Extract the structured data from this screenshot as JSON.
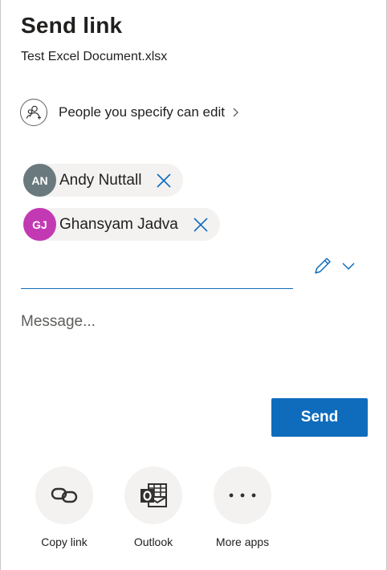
{
  "dialog": {
    "title": "Send link",
    "file_name": "Test Excel Document.xlsx"
  },
  "permission": {
    "label": "People you specify can edit",
    "icon": "people-icon"
  },
  "recipients": [
    {
      "initials": "AN",
      "name": "Andy Nuttall",
      "avatar_color": "#69797e"
    },
    {
      "initials": "GJ",
      "name": "Ghansyam Jadva",
      "avatar_color": "#c239b3"
    }
  ],
  "to_field": {
    "value": "",
    "placeholder": ""
  },
  "message": {
    "placeholder": "Message..."
  },
  "send_button": {
    "label": "Send",
    "color": "#0f6cbd"
  },
  "apps": [
    {
      "label": "Copy link",
      "icon": "link-icon"
    },
    {
      "label": "Outlook",
      "icon": "outlook-icon"
    },
    {
      "label": "More apps",
      "icon": "more-icon"
    }
  ]
}
